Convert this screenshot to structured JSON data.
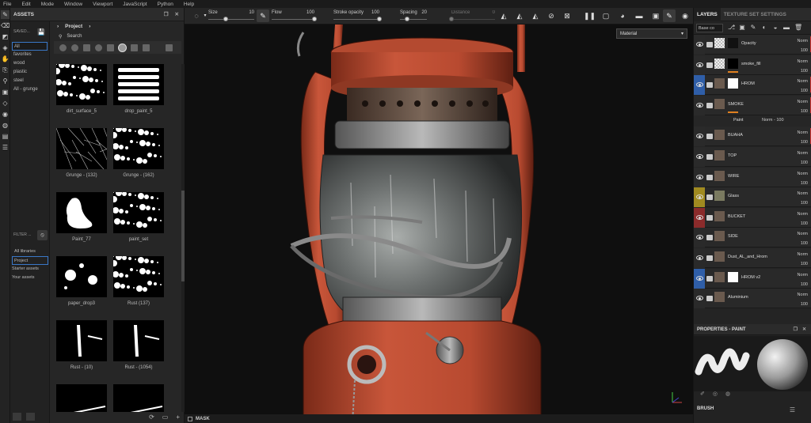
{
  "menu": [
    "File",
    "Edit",
    "Mode",
    "Window",
    "Viewport",
    "JavaScript",
    "Python",
    "Help"
  ],
  "tools": [
    "brush",
    "eraser",
    "projection",
    "geometry",
    "smudge",
    "clone",
    "picker",
    "fill",
    "polyfill",
    "bake",
    "material",
    "scene",
    "display"
  ],
  "assets": {
    "title": "ASSETS",
    "saved_label": "SAVED...",
    "libraries": [
      "All",
      "favorites",
      "wood",
      "plastic",
      "steel",
      "All - grunge"
    ],
    "selected_library": "All",
    "filter_label": "FILTER ...",
    "tree": [
      "All libraries",
      "Project",
      "Starter assets",
      "Your assets"
    ],
    "breadcrumb": "Project",
    "search_placeholder": "Search",
    "items": [
      {
        "name": "dirt_surface_5"
      },
      {
        "name": "drop_paint_5"
      },
      {
        "name": "Grunge - (132)"
      },
      {
        "name": "Grunge - (162)"
      },
      {
        "name": "Paint_77"
      },
      {
        "name": "paint_set"
      },
      {
        "name": "paper_drop3"
      },
      {
        "name": "Rust (137)"
      },
      {
        "name": "Rust - (10)"
      },
      {
        "name": "Rust - (1054)"
      },
      {
        "name": ""
      },
      {
        "name": ""
      }
    ]
  },
  "toolbar": {
    "params": [
      {
        "label": "Size",
        "value": "10",
        "fill": 0.38
      },
      {
        "label": "Flow",
        "value": "100",
        "fill": 1.0
      },
      {
        "label": "Stroke opacity",
        "value": "100",
        "fill": 1.0
      },
      {
        "label": "Spacing",
        "value": "20",
        "fill": 0.25
      },
      {
        "label": "Distance",
        "value": "0",
        "fill": 0.0
      }
    ]
  },
  "viewport": {
    "material_mode": "Material",
    "mask_label": "MASK"
  },
  "layers_panel": {
    "tab_layers": "LAYERS",
    "tab_texture_set": "TEXTURE SET SETTINGS",
    "blend_channel": "Base co",
    "blend_short": "Norm",
    "opacity": "100",
    "paint_sub": {
      "name": "Paint",
      "blend": "Norm",
      "opacity": "100"
    },
    "rows": [
      {
        "name": "Opacity",
        "eye_color": "#2a2a2a",
        "red": true
      },
      {
        "name": "smoke_fill",
        "eye_color": "#2a2a2a",
        "red": false
      },
      {
        "name": "HROM",
        "eye_color": "#2f5ea8",
        "red": true
      },
      {
        "name": "SMOKE",
        "eye_color": "#2a2a2a",
        "red": true
      },
      {
        "name": "BUAHA",
        "eye_color": "#2a2a2a",
        "red": true
      },
      {
        "name": "TOP",
        "eye_color": "#2a2a2a",
        "red": false
      },
      {
        "name": "WIRE",
        "eye_color": "#2a2a2a",
        "red": false
      },
      {
        "name": "Glass",
        "eye_color": "#a08a20",
        "red": false
      },
      {
        "name": "BUCKET",
        "eye_color": "#8b2b2b",
        "red": false
      },
      {
        "name": "SIDE",
        "eye_color": "#2a2a2a",
        "red": false
      },
      {
        "name": "Dust_AL_and_Hrom",
        "eye_color": "#2a2a2a",
        "red": false
      },
      {
        "name": "HROM v2",
        "eye_color": "#2f5ea8",
        "red": false
      },
      {
        "name": "Aluminium",
        "eye_color": "#2a2a2a",
        "red": false
      }
    ]
  },
  "properties": {
    "title": "PROPERTIES - PAINT",
    "section": "BRUSH"
  },
  "colors": {
    "accent_red": "#cc3333",
    "selection_blue": "#3a78c8",
    "lantern_red": "#c8502c"
  }
}
